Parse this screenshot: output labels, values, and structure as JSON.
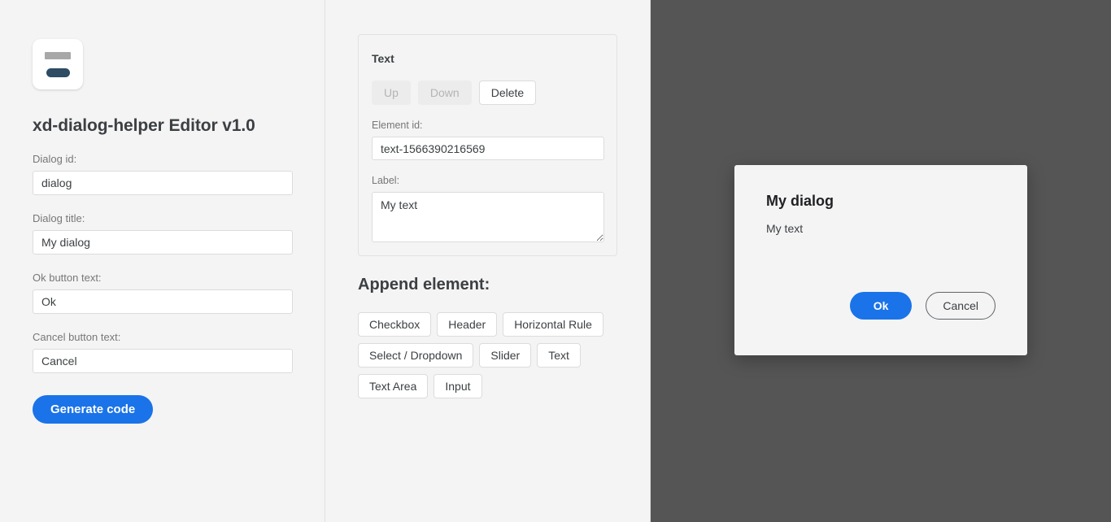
{
  "editor": {
    "logo": {
      "icon": "dialog-window-icon",
      "bar_color": "#a8a8a8",
      "pill_color": "#2e4c63"
    },
    "title": "xd-dialog-helper Editor v1.0",
    "fields": [
      {
        "id": "dialog-id",
        "label": "Dialog id:",
        "value": "dialog"
      },
      {
        "id": "dialog-title",
        "label": "Dialog title:",
        "value": "My dialog"
      },
      {
        "id": "ok-button-text",
        "label": "Ok button text:",
        "value": "Ok"
      },
      {
        "id": "cancel-button-text",
        "label": "Cancel button text:",
        "value": "Cancel"
      }
    ],
    "generate_button": "Generate code",
    "accent_color": "#1a73e8"
  },
  "element_editor": {
    "card_title": "Text",
    "actions": [
      {
        "label": "Up",
        "disabled": true
      },
      {
        "label": "Down",
        "disabled": true
      },
      {
        "label": "Delete",
        "disabled": false
      }
    ],
    "element_id": {
      "label": "Element id:",
      "value": "text-1566390216569"
    },
    "element_label": {
      "label": "Label:",
      "value": "My text"
    }
  },
  "append": {
    "heading": "Append element:",
    "buttons": [
      "Checkbox",
      "Header",
      "Horizontal Rule",
      "Select / Dropdown",
      "Slider",
      "Text",
      "Text Area",
      "Input"
    ]
  },
  "preview": {
    "backdrop_color": "#555555",
    "dialog": {
      "title": "My dialog",
      "body": "My text",
      "ok_label": "Ok",
      "cancel_label": "Cancel"
    }
  }
}
